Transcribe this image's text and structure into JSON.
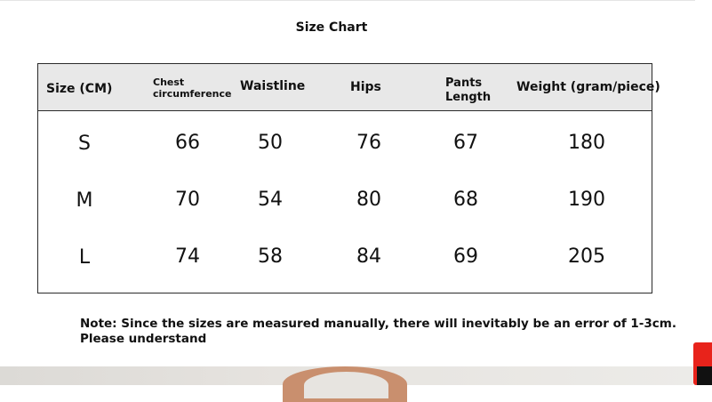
{
  "title": "Size Chart",
  "table": {
    "headers": {
      "size": "Size (CM)",
      "chest_line1": "Chest",
      "chest_line2": "circumference",
      "waist": "Waistline",
      "hips": "Hips",
      "pants_line1": "Pants",
      "pants_line2": "Length",
      "weight": "Weight (gram/piece)"
    },
    "rows": [
      {
        "size": "S",
        "chest": "66",
        "waist": "50",
        "hips": "76",
        "pants": "67",
        "weight": "180"
      },
      {
        "size": "M",
        "chest": "70",
        "waist": "54",
        "hips": "80",
        "pants": "68",
        "weight": "190"
      },
      {
        "size": "L",
        "chest": "74",
        "waist": "58",
        "hips": "84",
        "pants": "69",
        "weight": "205"
      }
    ]
  },
  "note": {
    "line1": "Note: Since the sizes are measured manually, there will inevitably be an error of 1-3cm.",
    "line2": "Please understand"
  },
  "colors": {
    "header_bg": "#e8e8e8",
    "border": "#2b2b2b",
    "side_badge": "#e8231b"
  }
}
